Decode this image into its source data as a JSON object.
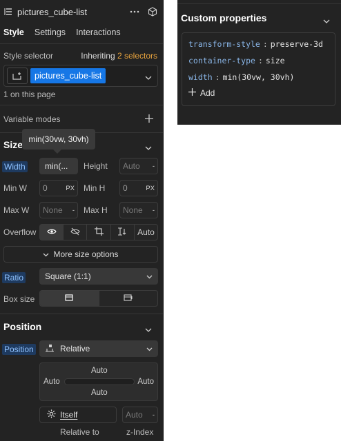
{
  "header": {
    "title": "pictures_cube-list",
    "more_icon": "ellipsis-icon",
    "cube_icon": "cube-icon"
  },
  "tabs": [
    {
      "label": "Style",
      "active": true
    },
    {
      "label": "Settings",
      "active": false
    },
    {
      "label": "Interactions",
      "active": false
    }
  ],
  "selector": {
    "label": "Style selector",
    "inheriting_prefix": "Inheriting",
    "inheriting_count": "2 selectors",
    "class_name": "pictures_cube-list",
    "on_page": "1 on this page"
  },
  "variable_modes": {
    "label": "Variable modes",
    "add_icon": "plus-icon"
  },
  "size": {
    "title": "Size",
    "tooltip": "min(30vw, 30vh)",
    "width_label": "Width",
    "width_value": "min(...",
    "height_label": "Height",
    "height_value": "Auto",
    "height_unit": "-",
    "minw_label": "Min W",
    "minw_value": "0",
    "minw_unit": "PX",
    "minh_label": "Min H",
    "minh_value": "0",
    "minh_unit": "PX",
    "maxw_label": "Max W",
    "maxw_value": "None",
    "maxw_unit": "-",
    "maxh_label": "Max H",
    "maxh_value": "None",
    "maxh_unit": "-",
    "overflow_label": "Overflow",
    "overflow_auto": "Auto",
    "more_options": "More size options",
    "ratio_label": "Ratio",
    "ratio_value": "Square (1:1)",
    "boxsize_label": "Box size"
  },
  "position": {
    "title": "Position",
    "label": "Position",
    "value": "Relative",
    "top": "Auto",
    "left": "Auto",
    "right": "Auto",
    "bottom": "Auto",
    "relative_to_value": "Itself",
    "relative_to_label": "Relative to",
    "zindex_value": "Auto",
    "zindex_unit": "-",
    "zindex_label": "z-Index"
  },
  "custom_properties": {
    "title": "Custom properties",
    "items": [
      {
        "key": "transform-style",
        "value": "preserve-3d"
      },
      {
        "key": "container-type",
        "value": "size"
      },
      {
        "key": "width",
        "value": "min(30vw, 30vh)"
      }
    ],
    "add_label": "Add"
  },
  "colors": {
    "accent_blue": "#1677e6",
    "label_blue_bg": "#1e3a5f",
    "label_blue_text": "#8fc2ff",
    "inherit_orange": "#e8a33d",
    "panel_bg": "#232323"
  }
}
